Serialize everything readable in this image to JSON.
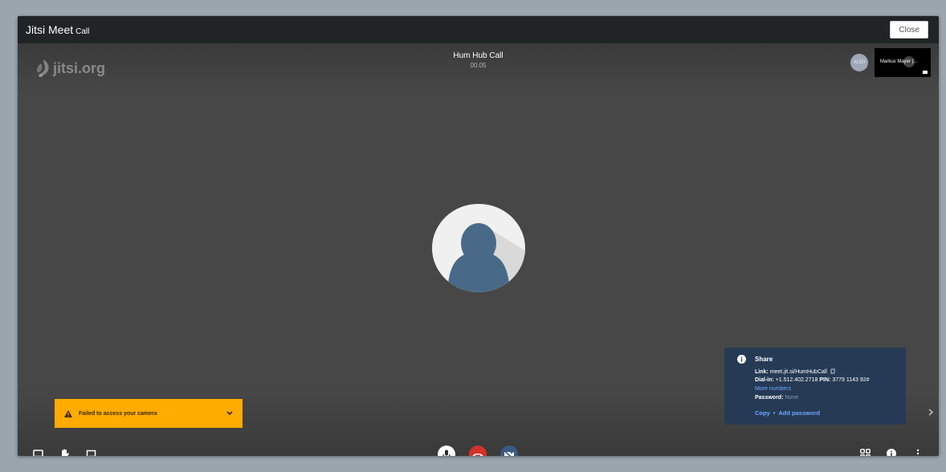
{
  "window": {
    "title": "Jitsi Meet",
    "title_suffix": "Call",
    "close_label": "Close"
  },
  "logo": {
    "text": "jitsi.org"
  },
  "call": {
    "title": "Hum Hub Call",
    "timer": "00:05"
  },
  "participants": {
    "audio_badge": "AUDI",
    "thumbnail_name": "Markus Mayer (..."
  },
  "warning": {
    "text": "Failed to access your camera"
  },
  "share": {
    "title": "Share",
    "link_label": "Link:",
    "link_value": "meet.jit.si/HumHubCall",
    "dialin_label": "Dial-in:",
    "dialin_value": "+1.512.402.2718",
    "pin_label": "PIN:",
    "pin_value": "3779 1143 92#",
    "more_numbers": "More numbers",
    "password_label": "Password:",
    "password_value": "None",
    "copy_label": "Copy",
    "separator": "•",
    "add_password_label": "Add password"
  },
  "icons": {
    "logo": "jitsi-logo-icon",
    "screen_share": "screen-share-icon",
    "raise_hand": "raise-hand-icon",
    "chat": "chat-icon",
    "microphone": "microphone-icon",
    "hangup": "hangup-icon",
    "camera_off": "camera-off-icon",
    "tile_view": "tile-view-icon",
    "info": "info-icon",
    "more": "more-vertical-icon",
    "warning": "warning-icon",
    "chevron_down": "chevron-down-icon",
    "chevron_right": "chevron-right-icon",
    "copy": "copy-icon"
  },
  "colors": {
    "stage": "#474747",
    "titlebar": "#202427",
    "warning": "#ffab00",
    "share_panel": "#263a55",
    "hangup": "#d5322b",
    "camera_off": "#3a5a84",
    "link": "#6fa6ff"
  }
}
